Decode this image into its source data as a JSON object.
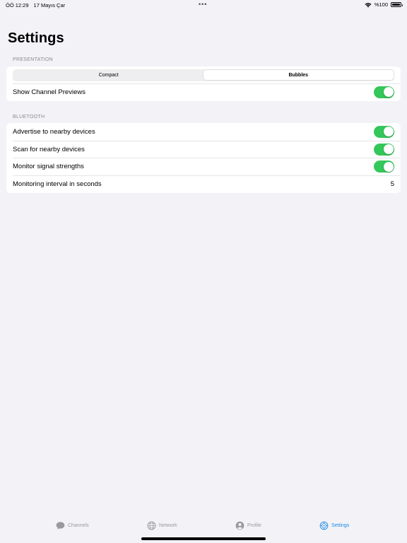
{
  "status_bar": {
    "time": "ÖÖ 12:29",
    "date": "17 Mayıs Çar",
    "dots": "•••",
    "battery_text": "%100"
  },
  "page": {
    "title": "Settings"
  },
  "presentation": {
    "header": "PRESENTATION",
    "segments": [
      {
        "label": "Compact",
        "selected": false
      },
      {
        "label": "Bubbles",
        "selected": true
      }
    ],
    "show_channel_previews": {
      "label": "Show Channel Previews",
      "on": true
    }
  },
  "bluetooth": {
    "header": "BLUETOOTH",
    "advertise": {
      "label": "Advertise to nearby devices",
      "on": true
    },
    "scan": {
      "label": "Scan for nearby devices",
      "on": true
    },
    "monitor": {
      "label": "Monitor signal strengths",
      "on": true
    },
    "interval": {
      "label": "Monitoring interval in seconds",
      "value": "5"
    }
  },
  "tabs": [
    {
      "label": "Channels",
      "icon": "chat-bubble-icon",
      "active": false
    },
    {
      "label": "Network",
      "icon": "globe-icon",
      "active": false
    },
    {
      "label": "Profile",
      "icon": "person-circle-icon",
      "active": false
    },
    {
      "label": "Settings",
      "icon": "gear-icon",
      "active": true
    }
  ],
  "colors": {
    "toggle_on": "#34c759",
    "accent": "#1e88e5",
    "background": "#f2f2f7"
  }
}
